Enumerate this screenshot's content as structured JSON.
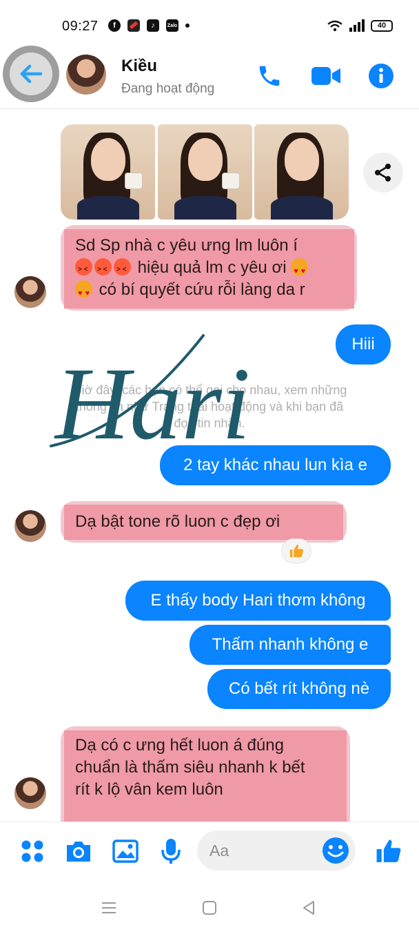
{
  "status_bar": {
    "time": "09:27",
    "apps": [
      "facebook-icon",
      "red-app-icon",
      "tiktok-icon",
      "zalo-icon"
    ],
    "zalo_label": "Zalo",
    "battery": "40"
  },
  "header": {
    "name": "Kiều",
    "status": "Đang hoạt động",
    "accent": "#0a84ff"
  },
  "messages": {
    "in_1_lines": [
      "Sd Sp nhà c yêu ưng lm luôn í",
      "hiệu quả lm c yêu ơi",
      "có bí quyết cứu rỗi làng da r"
    ],
    "out_1": "Hiii",
    "system_note": "Giờ đây, các bạn có thể gọi cho nhau, xem những thông tin như Trạng thái hoạt động và khi bạn đã đọc tin nhắn.",
    "watermark": "Hari",
    "out_2": "2 tay khác nhau lun kìa e",
    "in_2": "Dạ bật tone rõ luon c đẹp ơi",
    "out_3": "E thấy body Hari thơm không",
    "out_4": "Thấm nhanh không e",
    "out_5": "Có bết rít không nè",
    "in_3_lines": [
      "Dạ có c ưng hết luon á đúng",
      "chuẩn là thấm siêu nhanh k bết",
      "rít k lộ vân kem luôn"
    ]
  },
  "composer": {
    "placeholder": "Aa"
  },
  "colors": {
    "bubble_out": "#0a84ff",
    "bubble_in_highlight": "#ef9aa6",
    "watermark": "#1f5b6b"
  }
}
